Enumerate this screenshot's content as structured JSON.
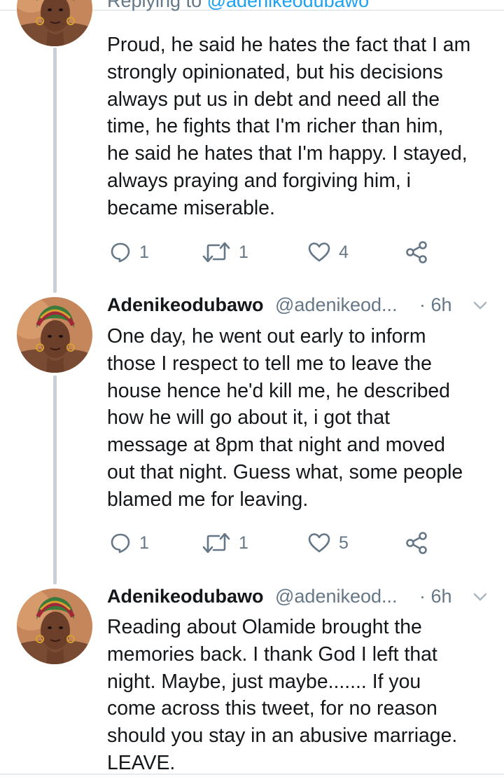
{
  "first_tweet": {
    "replying_prefix": "Replying to",
    "replying_handle": "@adenikeodubawo",
    "lines": [
      "Proud, he said he hates the fact that I am",
      "strongly opinionated, but his decisions",
      "always put us in debt and need all the",
      "time, he fights that I'm richer than him,",
      "he said he hates that I'm happy. I stayed,",
      "always praying and forgiving him, i",
      "became miserable."
    ],
    "reply_count": "1",
    "retweet_count": "1",
    "like_count": "4"
  },
  "second_tweet": {
    "name": "Adenikeodubawo",
    "handle": "@adenikeod...",
    "time": "· 6h",
    "lines": [
      "One day, he went out early to inform",
      "those I respect  to tell me to leave the",
      "house hence he'd kill me, he described",
      "how he will go about it, i got that",
      "message at 8pm that night and moved",
      "out that night. Guess what, some people",
      "blamed me for leaving."
    ],
    "reply_count": "1",
    "retweet_count": "1",
    "like_count": "5"
  },
  "third_tweet": {
    "name": "Adenikeodubawo",
    "handle": "@adenikeod...",
    "time": "· 6h",
    "lines": [
      "Reading about Olamide brought the",
      "memories back. I thank God I left that",
      "night. Maybe, just maybe.......  If you",
      "come across this tweet, for no reason",
      "should you stay in an abusive marriage.",
      "LEAVE."
    ]
  },
  "icons": {
    "reply": "reply-icon",
    "retweet": "retweet-icon",
    "like": "heart-icon",
    "share": "share-icon",
    "caret": "chevron-down-icon"
  },
  "colors": {
    "text": "#14171a",
    "secondary": "#657786",
    "link": "#1da1f2",
    "thread": "#c8d0d6"
  }
}
